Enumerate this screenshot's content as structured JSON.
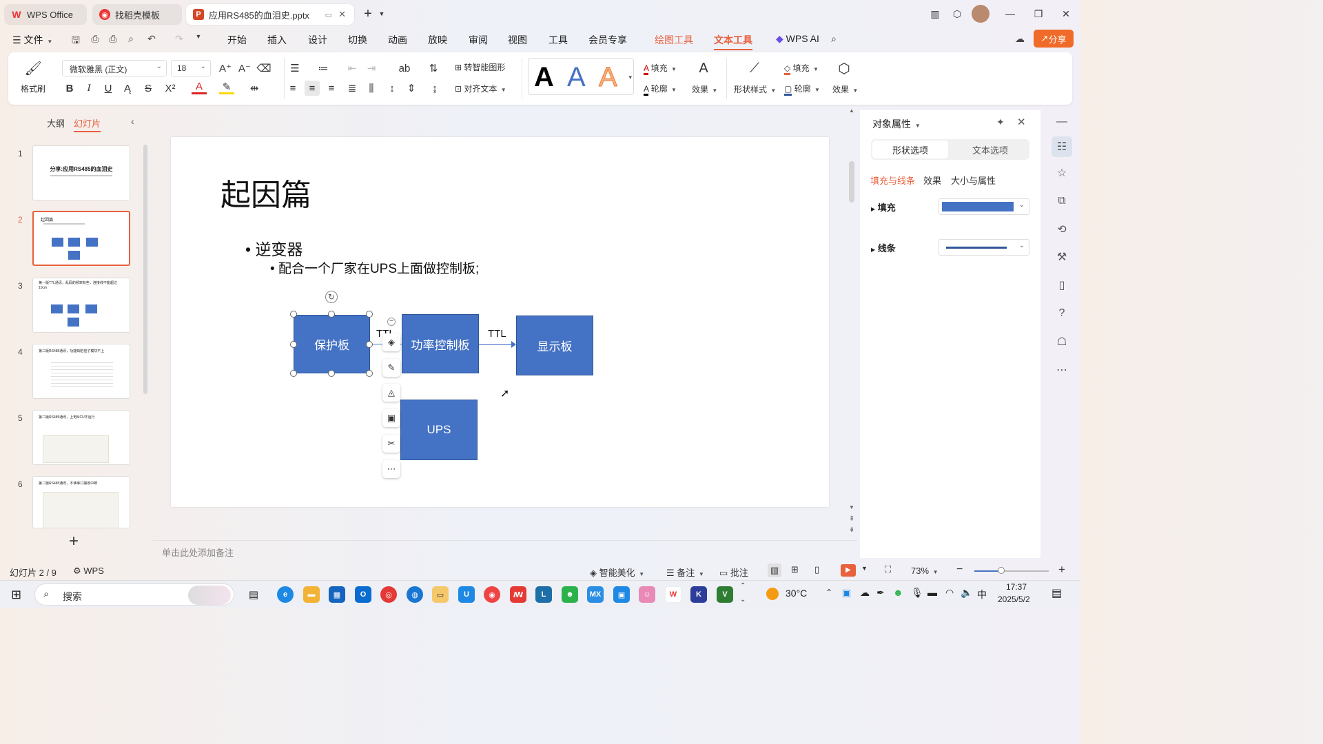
{
  "tabs": [
    {
      "label": "WPS Office"
    },
    {
      "label": "找稻壳模板"
    },
    {
      "label": "应用RS485的血泪史.pptx"
    }
  ],
  "menu": {
    "file": "文件",
    "items": [
      "开始",
      "插入",
      "设计",
      "切换",
      "动画",
      "放映",
      "审阅",
      "视图",
      "工具",
      "会员专享",
      "绘图工具",
      "文本工具"
    ],
    "wps_ai": "WPS AI",
    "share": "分享"
  },
  "ribbon": {
    "format_painter": "格式刷",
    "font_name": "微软雅黑 (正文)",
    "font_size": "18",
    "smart_graphic": "转智能图形",
    "align_text": "对齐文本",
    "fill": "填充",
    "outline": "轮廓",
    "effect": "效果",
    "shape_style": "形状样式",
    "shape_fill": "填充",
    "shape_outline": "轮廓",
    "shape_effect": "效果",
    "art_sample": "A"
  },
  "sidepanel": {
    "tab_outline": "大纲",
    "tab_slides": "幻灯片",
    "thumbs": [
      {
        "num": "1",
        "title": "分享:应用RS485的血泪史"
      },
      {
        "num": "2",
        "title": "起因篇"
      },
      {
        "num": "3",
        "title": "第一版TTL通讯，乱码的频率有些，连接线不能超过10cm"
      },
      {
        "num": "4",
        "title": "第二版RS485通讯，功能缺陷但子模块不上"
      },
      {
        "num": "5",
        "title": "第二版RS485通讯，上电MCU不运行"
      },
      {
        "num": "6",
        "title": "第二版RS485通讯，不读串口接收中断"
      }
    ]
  },
  "slide": {
    "title": "起因篇",
    "bullet1": "逆变器",
    "bullet2": "配合一个厂家在UPS上面做控制板;",
    "box_protect": "保护板",
    "box_power": "功率控制板",
    "box_display": "显示板",
    "box_ups": "UPS",
    "label_ttl1": "TTL",
    "label_ttl2": "TTL"
  },
  "notes_placeholder": "单击此处添加备注",
  "rightpanel": {
    "title": "对象属性",
    "tab_shape": "形状选项",
    "tab_text": "文本选项",
    "sub_fill_line": "填充与线条",
    "sub_effect": "效果",
    "sub_size": "大小与属性",
    "fill_label": "填充",
    "line_label": "线条",
    "fill_color": "#4472c4"
  },
  "status": {
    "slide_pos": "幻灯片 2 / 9",
    "wps": "WPS",
    "smart_beautify": "智能美化",
    "notes": "备注",
    "comments": "批注",
    "zoom": "73%"
  },
  "taskbar": {
    "search": "搜索",
    "temp": "30°C",
    "ime": "中",
    "time": "17:37",
    "date": "2025/5/2"
  }
}
